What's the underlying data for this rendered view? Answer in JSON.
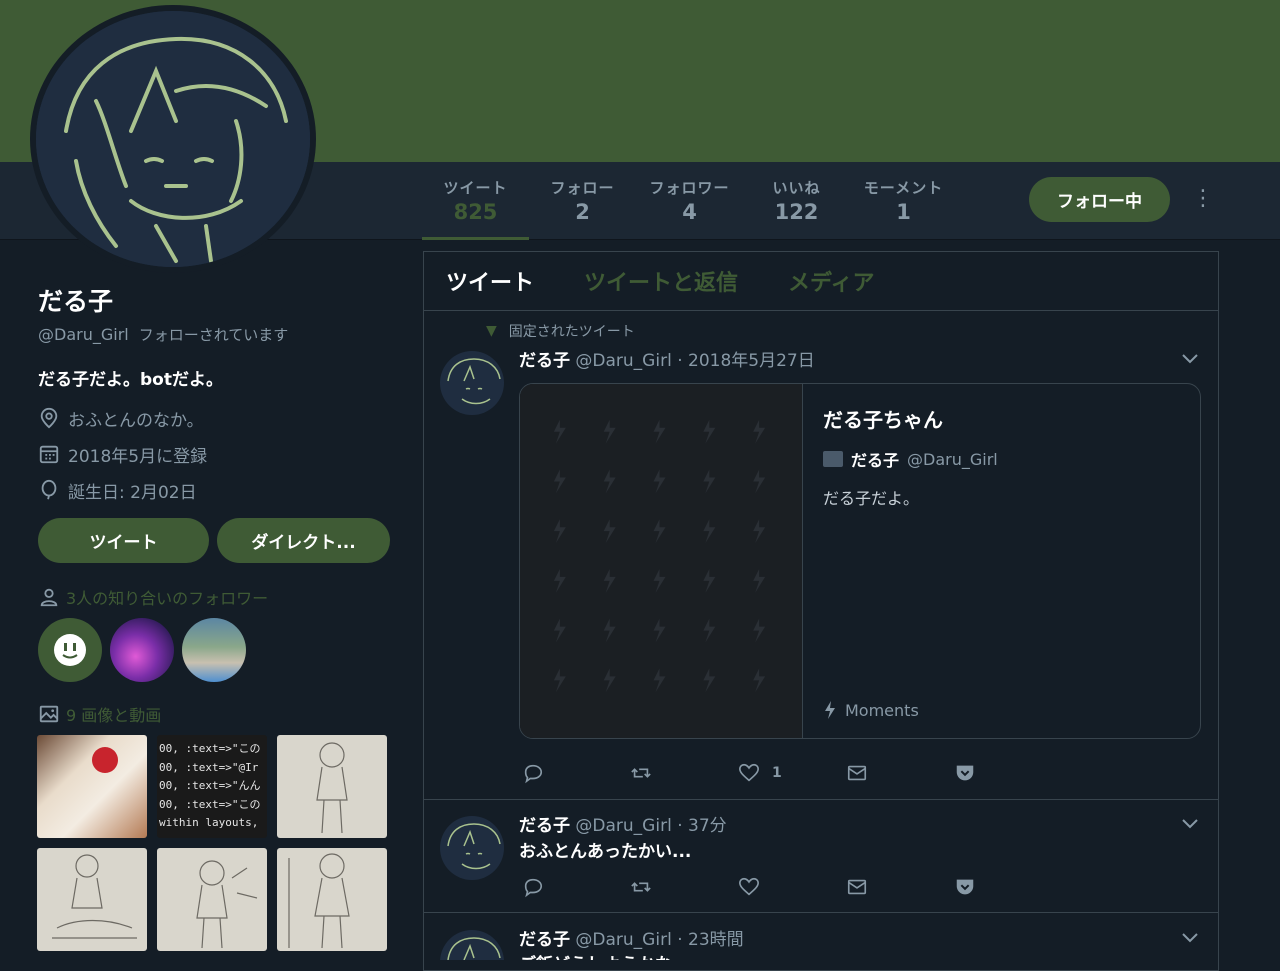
{
  "profile": {
    "name": "だる子",
    "handle": "@Daru_Girl",
    "follows_you": "フォローされています",
    "bio": "だる子だよ。botだよ。",
    "location": "おふとんのなか。",
    "joined": "2018年5月に登録",
    "birthday": "誕生日: 2月02日"
  },
  "stats": [
    {
      "label": "ツイート",
      "value": "825"
    },
    {
      "label": "フォロー",
      "value": "2"
    },
    {
      "label": "フォロワー",
      "value": "4"
    },
    {
      "label": "いいね",
      "value": "122"
    },
    {
      "label": "モーメント",
      "value": "1"
    }
  ],
  "follow_button": "フォロー中",
  "buttons": {
    "tweet": "ツイート",
    "dm": "ダイレクト..."
  },
  "known_followers": "3人の知り合いのフォロワー",
  "media_title": "9 画像と動画",
  "code_lines": [
    "00, :text=>\"この",
    "00, :text=>\"@Ir",
    "00, :text=>\"んん",
    "00, :text=>\"この",
    "within layouts,"
  ],
  "tabs": [
    "ツイート",
    "ツイートと返信",
    "メディア"
  ],
  "pinned_label": "固定されたツイート",
  "tweets": [
    {
      "name": "だる子",
      "handle": "@Daru_Girl",
      "time": "· 2018年5月27日",
      "text": "",
      "likes": "1"
    },
    {
      "name": "だる子",
      "handle": "@Daru_Girl",
      "time": "· 37分",
      "text": "おふとんあったかい...",
      "likes": ""
    },
    {
      "name": "だる子",
      "handle": "@Daru_Girl",
      "time": "· 23時間",
      "text": "ご飯どうしようかな",
      "likes": ""
    }
  ],
  "card": {
    "title": "だる子ちゃん",
    "author_name": "だる子",
    "author_handle": "@Daru_Girl",
    "text": "だる子だよ。",
    "moments": "Moments"
  },
  "colors": {
    "accent": "#3f5b35",
    "background": "#141d26",
    "navbar": "#1c2733",
    "muted": "#8899a6"
  }
}
